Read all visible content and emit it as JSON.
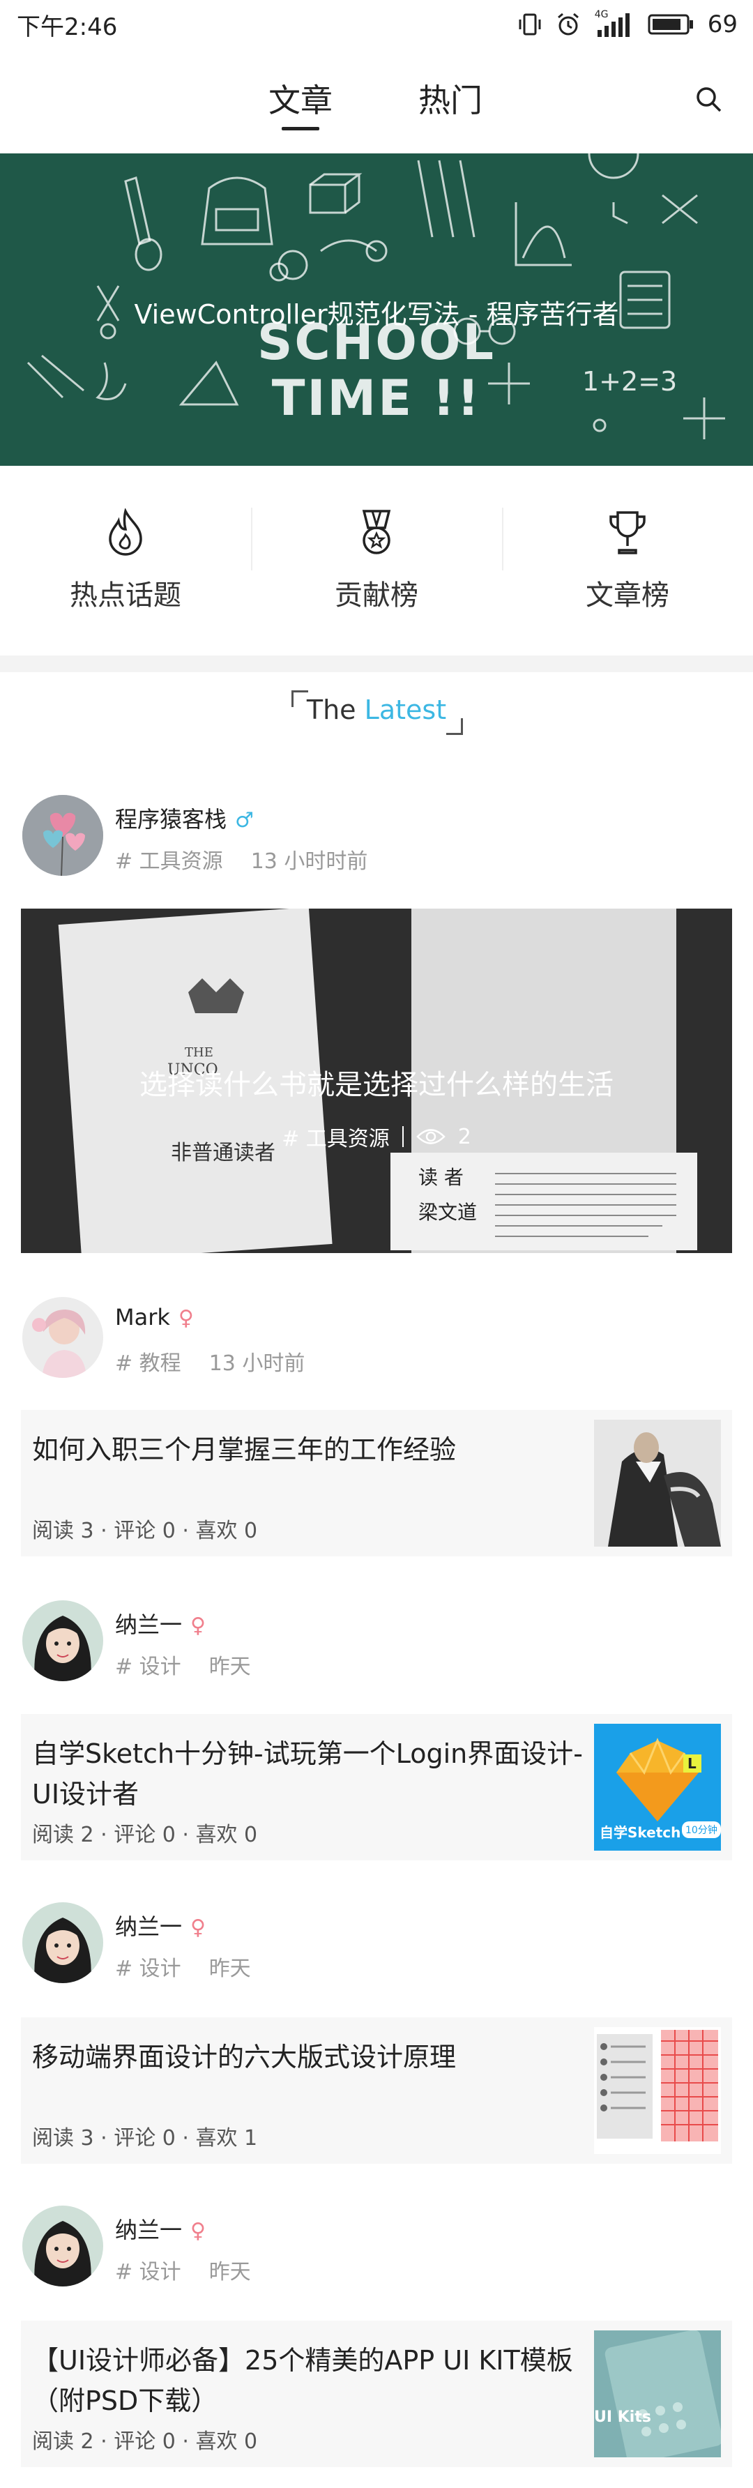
{
  "status_bar": {
    "time": "下午2:46",
    "network": "4G",
    "battery": "69"
  },
  "header": {
    "tabs": [
      "文章",
      "热门"
    ],
    "active_tab": "文章"
  },
  "banner": {
    "title": "ViewController规范化写法 - 程序苦行者",
    "art_line1": "SCHOOL",
    "art_line2": "TIME !!",
    "art_formula": "1+2=3"
  },
  "quick_links": [
    {
      "label": "热点话题",
      "icon": "flame-icon"
    },
    {
      "label": "贡献榜",
      "icon": "medal-icon"
    },
    {
      "label": "文章榜",
      "icon": "trophy-icon"
    }
  ],
  "latest": {
    "prefix": "The",
    "highlight": "Latest",
    "accent": "#3cb7e3"
  },
  "posts": [
    {
      "user": "程序猿客栈",
      "gender": "♂",
      "tag": "# 工具资源",
      "time": "13 小时时前",
      "feature": {
        "title": "选择读什么书就是选择过什么样的生活",
        "tag": "# 工具资源",
        "views": "2"
      }
    },
    {
      "user": "Mark",
      "gender": "♀",
      "tag": "# 教程",
      "time": "13 小时前",
      "title": "如何入职三个月掌握三年的工作经验",
      "stats": "阅读 3 · 评论 0 · 喜欢 0"
    },
    {
      "user": "纳兰一",
      "gender": "♀",
      "tag": "# 设计",
      "time": "昨天",
      "title": "自学Sketch十分钟-试玩第一个Login界面设计-UI设计者",
      "stats": "阅读 2 · 评论 0 · 喜欢 0",
      "thumb_text": "自学Sketch",
      "thumb_badge": "10分钟"
    },
    {
      "user": "纳兰一",
      "gender": "♀",
      "tag": "# 设计",
      "time": "昨天",
      "title": "移动端界面设计的六大版式设计原理",
      "stats": "阅读 3 · 评论 0 · 喜欢 1"
    },
    {
      "user": "纳兰一",
      "gender": "♀",
      "tag": "# 设计",
      "time": "昨天",
      "title": "【UI设计师必备】25个精美的APP UI KIT模板（附PSD下载）",
      "stats": "阅读 2 · 评论 0 · 喜欢 0",
      "thumb_text": "UI Kits"
    }
  ]
}
